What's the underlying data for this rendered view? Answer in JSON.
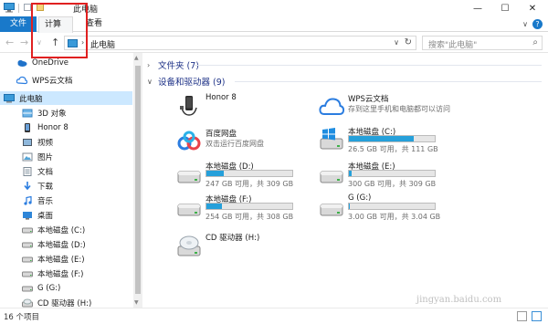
{
  "window": {
    "title": "此电脑",
    "icons": [
      "pc-icon",
      "properties-icon",
      "new-folder-icon"
    ],
    "controls": [
      "minimize-icon",
      "maximize-icon",
      "close-icon"
    ]
  },
  "ribbon": {
    "tabs": [
      "文件",
      "计算机",
      "查看"
    ],
    "active_tab": "计算机",
    "accent": "#1979ca"
  },
  "address": {
    "path": "此电脑",
    "search_placeholder": "搜索\"此电脑\""
  },
  "nav": {
    "items": [
      {
        "label": "OneDrive",
        "icon": "onedrive-icon"
      },
      {
        "label": "WPS云文档",
        "icon": "wps-cloud-icon"
      },
      {
        "label": "此电脑",
        "icon": "pc-icon",
        "selected": true
      },
      {
        "label": "3D 对象",
        "icon": "3d-objects-icon"
      },
      {
        "label": "Honor 8",
        "icon": "phone-icon"
      },
      {
        "label": "视频",
        "icon": "videos-icon"
      },
      {
        "label": "图片",
        "icon": "pictures-icon"
      },
      {
        "label": "文档",
        "icon": "documents-icon"
      },
      {
        "label": "下载",
        "icon": "downloads-icon"
      },
      {
        "label": "音乐",
        "icon": "music-icon"
      },
      {
        "label": "桌面",
        "icon": "desktop-icon"
      },
      {
        "label": "本地磁盘 (C:)",
        "icon": "drive-icon"
      },
      {
        "label": "本地磁盘 (D:)",
        "icon": "drive-icon"
      },
      {
        "label": "本地磁盘 (E:)",
        "icon": "drive-icon"
      },
      {
        "label": "本地磁盘 (F:)",
        "icon": "drive-icon"
      },
      {
        "label": "G (G:)",
        "icon": "drive-icon"
      },
      {
        "label": "CD 驱动器 (H:)",
        "icon": "cd-drive-icon"
      }
    ]
  },
  "content": {
    "folders_group": "文件夹 (7)",
    "devices_group": "设备和驱动器 (9)",
    "devices": [
      {
        "name": "Honor 8",
        "icon": "phone-icon"
      },
      {
        "name": "WPS云文档",
        "sub": "存到这里手机和电脑都可以访问",
        "icon": "wps-cloud-icon"
      },
      {
        "name": "百度网盘",
        "sub": "双击运行百度网盘",
        "icon": "baidu-netdisk-icon"
      },
      {
        "name": "本地磁盘 (C:)",
        "size": "26.5 GB 可用，共 111 GB",
        "fill": 0.76,
        "icon": "windows-drive-icon"
      },
      {
        "name": "本地磁盘 (D:)",
        "size": "247 GB 可用，共 309 GB",
        "fill": 0.2,
        "icon": "drive-icon"
      },
      {
        "name": "本地磁盘 (E:)",
        "size": "300 GB 可用，共 309 GB",
        "fill": 0.03,
        "icon": "drive-icon"
      },
      {
        "name": "本地磁盘 (F:)",
        "size": "254 GB 可用，共 308 GB",
        "fill": 0.18,
        "icon": "drive-icon"
      },
      {
        "name": "G (G:)",
        "size": "3.00 GB 可用，共 3.04 GB",
        "fill": 0.01,
        "icon": "drive-icon"
      },
      {
        "name": "CD 驱动器 (H:)",
        "icon": "cd-drive-icon"
      }
    ]
  },
  "status": {
    "count": "16 个项目"
  },
  "watermark": "jingyan.baidu.com"
}
